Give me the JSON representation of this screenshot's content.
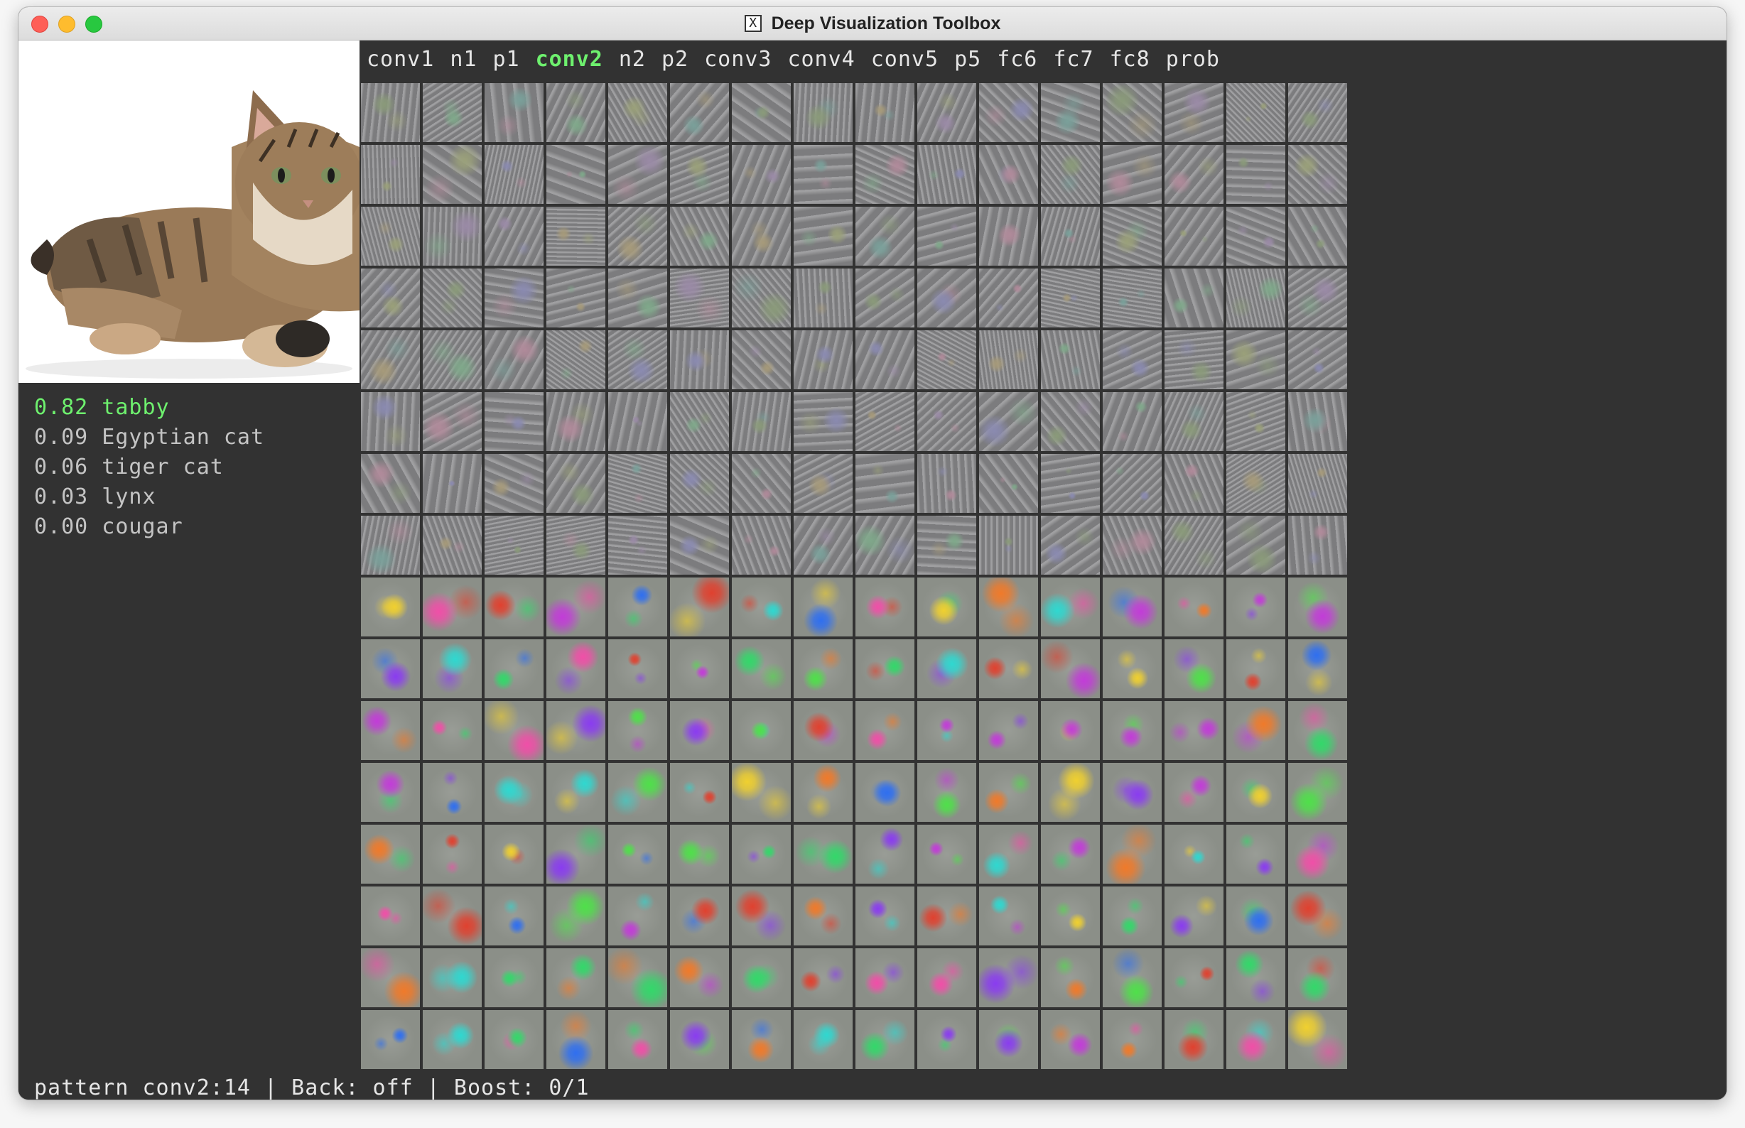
{
  "window": {
    "title": "Deep Visualization Toolbox",
    "icon": "x11-icon",
    "icon_glyph": "X"
  },
  "layers": {
    "tabs": [
      {
        "label": "conv1",
        "active": false
      },
      {
        "label": "n1",
        "active": false
      },
      {
        "label": "p1",
        "active": false
      },
      {
        "label": "conv2",
        "active": true
      },
      {
        "label": "n2",
        "active": false
      },
      {
        "label": "p2",
        "active": false
      },
      {
        "label": "conv3",
        "active": false
      },
      {
        "label": "conv4",
        "active": false
      },
      {
        "label": "conv5",
        "active": false
      },
      {
        "label": "p5",
        "active": false
      },
      {
        "label": "fc6",
        "active": false
      },
      {
        "label": "fc7",
        "active": false
      },
      {
        "label": "fc8",
        "active": false
      },
      {
        "label": "prob",
        "active": false
      }
    ],
    "active_color": "#6ef06e"
  },
  "predictions": [
    {
      "text": "0.82 tabby"
    },
    {
      "text": "0.09 Egyptian cat"
    },
    {
      "text": "0.06 tiger cat"
    },
    {
      "text": "0.03 lynx"
    },
    {
      "text": "0.00 cougar"
    }
  ],
  "visualization_grid": {
    "rows": 16,
    "cols": 16,
    "content": "conv2 channel visualizations"
  },
  "status": {
    "text": "pattern conv2:14 | Back: off | Boost: 0/1"
  },
  "colors": {
    "background": "#323232",
    "text": "#e6e6e6",
    "highlight": "#6ef06e"
  }
}
